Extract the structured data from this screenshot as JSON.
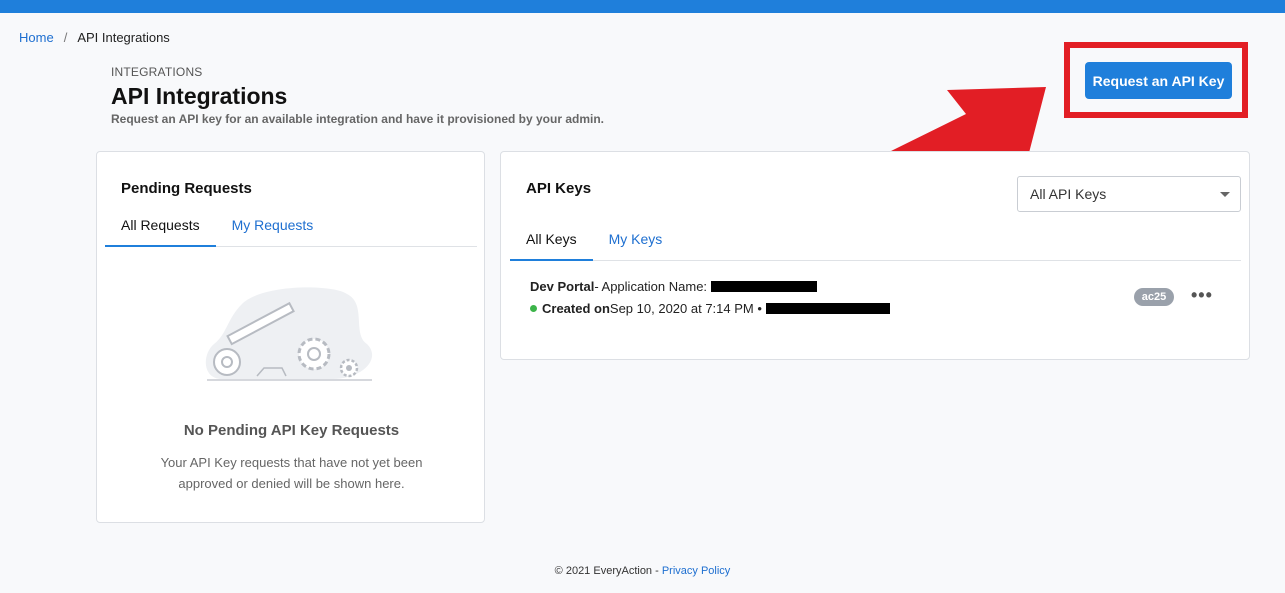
{
  "breadcrumb": {
    "home": "Home",
    "separator": "/",
    "current": "API Integrations"
  },
  "header": {
    "eyebrow": "INTEGRATIONS",
    "title": "API Integrations",
    "subtitle": "Request an API key for an available integration and have it provisioned by your admin.",
    "request_button": "Request an API Key"
  },
  "pending": {
    "title": "Pending Requests",
    "tabs": [
      {
        "label": "All Requests"
      },
      {
        "label": "My Requests"
      }
    ],
    "empty_title": "No Pending API Key Requests",
    "empty_text": "Your API Key requests that have not yet been approved or denied will be shown here."
  },
  "keys": {
    "title": "API Keys",
    "filter_value": "All API Keys",
    "tabs": [
      {
        "label": "All Keys"
      },
      {
        "label": "My Keys"
      }
    ],
    "item": {
      "name": "Dev Portal",
      "app_label": " - Application Name:",
      "created_label": "Created on",
      "created_value": " Sep 10, 2020 at 7:14 PM •",
      "tag": "ac25",
      "more": "•••"
    }
  },
  "footer": {
    "copyright": "© 2021 EveryAction -",
    "privacy": "Privacy Policy"
  },
  "colors": {
    "accent": "#1f7fdb",
    "highlight": "#e21e25",
    "status_active": "#3cb44a"
  }
}
